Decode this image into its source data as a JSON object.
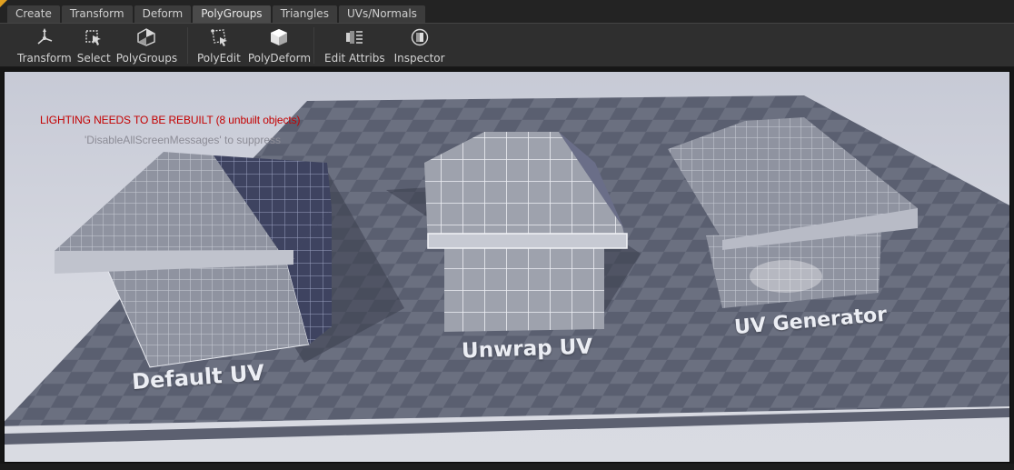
{
  "tabs": [
    {
      "label": "Create",
      "active": false
    },
    {
      "label": "Transform",
      "active": false
    },
    {
      "label": "Deform",
      "active": false
    },
    {
      "label": "PolyGroups",
      "active": true
    },
    {
      "label": "Triangles",
      "active": false
    },
    {
      "label": "UVs/Normals",
      "active": false
    }
  ],
  "toolbar": {
    "tools": [
      {
        "label": "Transform",
        "icon": "transform-icon"
      },
      {
        "label": "Select",
        "icon": "select-icon"
      },
      {
        "label": "PolyGroups",
        "icon": "polygroups-icon"
      },
      {
        "label": "PolyEdit",
        "icon": "polyedit-icon"
      },
      {
        "label": "PolyDeform",
        "icon": "polydeform-icon"
      },
      {
        "label": "Edit Attribs",
        "icon": "edit-attribs-icon"
      },
      {
        "label": "Inspector",
        "icon": "inspector-icon"
      }
    ]
  },
  "viewport": {
    "warning": "LIGHTING NEEDS TO BE REBUILT (8 unbuilt objects)",
    "hint": "'DisableAllScreenMessages' to suppress",
    "labels": {
      "default_uv": "Default UV",
      "unwrap_uv": "Unwrap UV",
      "uv_generator": "UV Generator"
    }
  },
  "colors": {
    "warning": "#c40000",
    "active_tab": "#4a4a4a",
    "toolbar_bg": "#2f2f2f",
    "viewport_sky": "#d7d9e1"
  }
}
